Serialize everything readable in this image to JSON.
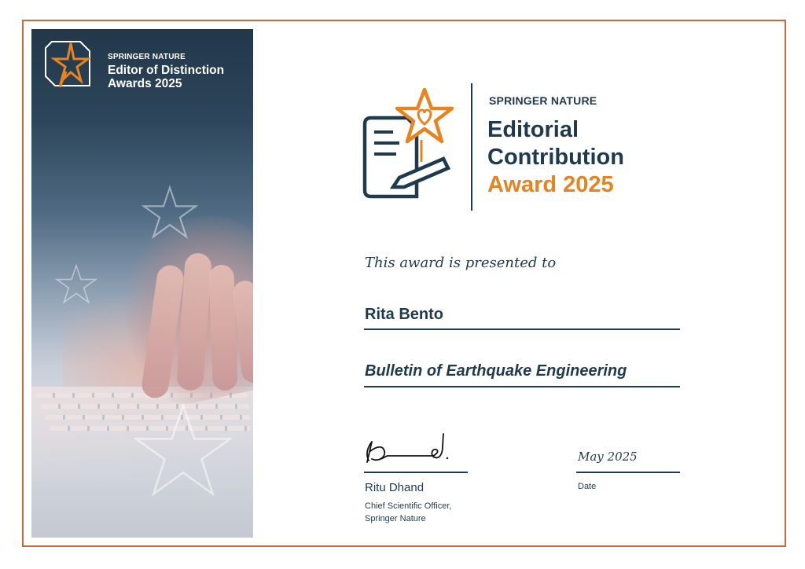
{
  "colors": {
    "navy": "#1f3a4d",
    "orange": "#e7841f",
    "border": "#c8693a"
  },
  "left_panel": {
    "brand": "SPRINGER NATURE",
    "title_line1": "Editor of Distinction",
    "title_line2": "Awards 2025",
    "logo_icon": "star-badge-icon"
  },
  "award": {
    "brand": "SPRINGER NATURE",
    "title_line1": "Editorial",
    "title_line2": "Contribution",
    "title_line3": "Award 2025",
    "icon": "document-star-heart-icon"
  },
  "presentation": {
    "intro": "This award is presented to",
    "recipient": "Rita Bento",
    "journal": "Bulletin of Earthquake Engineering"
  },
  "signatory": {
    "name": "Ritu Dhand",
    "role_line1": "Chief Scientific Officer,",
    "role_line2": "Springer Nature"
  },
  "date": {
    "value": "May 2025",
    "label": "Date"
  }
}
